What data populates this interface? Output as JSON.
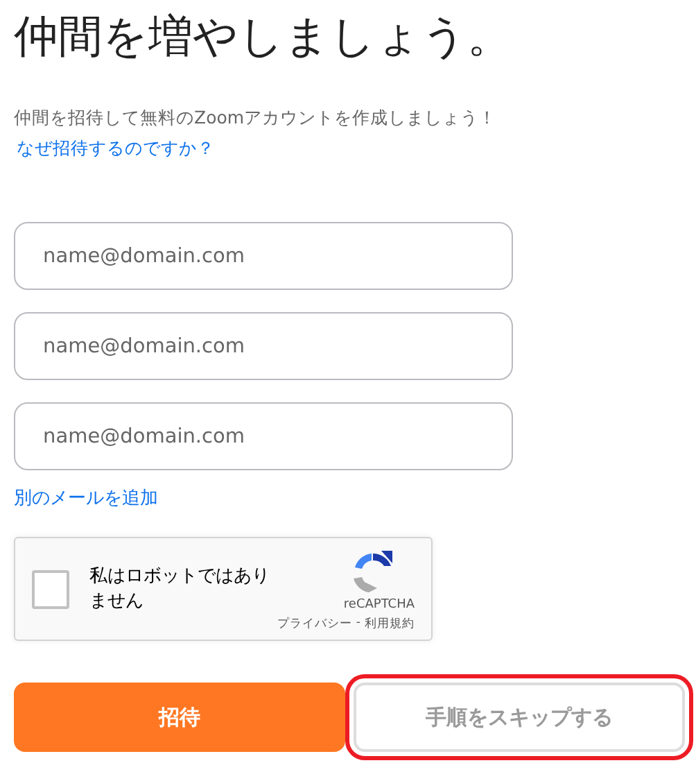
{
  "title": "仲間を増やしましょう。",
  "subtitle": "仲間を招待して無料のZoomアカウントを作成しましょう！",
  "why_link": "なぜ招待するのですか？",
  "email_fields": [
    {
      "placeholder": "name@domain.com"
    },
    {
      "placeholder": "name@domain.com"
    },
    {
      "placeholder": "name@domain.com"
    }
  ],
  "add_email_link": "別のメールを追加",
  "captcha": {
    "checked": false,
    "label": "私はロボットではありません",
    "brand": "reCAPTCHA",
    "privacy": "プライバシー",
    "separator": "-",
    "terms": "利用規約"
  },
  "buttons": [
    {
      "kind": "primary",
      "label": "招待",
      "highlighted": false
    },
    {
      "kind": "secondary",
      "label": "手順をスキップする",
      "highlighted": true
    }
  ]
}
